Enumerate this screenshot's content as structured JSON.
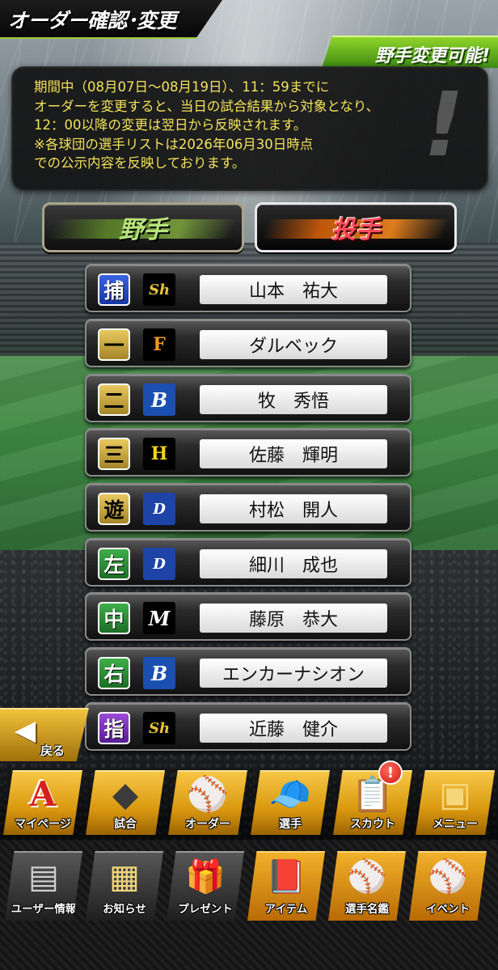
{
  "header": {
    "title": "オーダー確認･変更",
    "badge": "野手変更可能!"
  },
  "notice": {
    "text": "期間中（08月07日～08月19日）、11：59までに\nオーダーを変更すると、当日の試合結果から対象となり、\n12：00以降の変更は翌日から反映されます。\n※各球団の選手リストは2026年06月30日時点\nでの公示内容を反映しております。",
    "mark": "!"
  },
  "tabs": {
    "fielder": "野手",
    "pitcher": "投手"
  },
  "lineup": [
    {
      "position": "捕",
      "team_logo": "Sh",
      "name": "山本　祐大"
    },
    {
      "position": "一",
      "team_logo": "F",
      "name": "ダルベック"
    },
    {
      "position": "二",
      "team_logo": "B",
      "name": "牧　秀悟"
    },
    {
      "position": "三",
      "team_logo": "H",
      "name": "佐藤　輝明"
    },
    {
      "position": "遊",
      "team_logo": "D",
      "name": "村松　開人"
    },
    {
      "position": "左",
      "team_logo": "D",
      "name": "細川　成也"
    },
    {
      "position": "中",
      "team_logo": "M",
      "name": "藤原　恭大"
    },
    {
      "position": "右",
      "team_logo": "B",
      "name": "エンカーナシオン"
    },
    {
      "position": "指",
      "team_logo": "Sh",
      "name": "近藤　健介"
    }
  ],
  "back_button": {
    "arrow": "◀",
    "label": "戻る"
  },
  "main_menu": [
    {
      "icon": "A",
      "label": "マイページ"
    },
    {
      "icon": "◆",
      "label": "試合"
    },
    {
      "icon": "⚾",
      "label": "オーダー"
    },
    {
      "icon": "🧢",
      "label": "選手"
    },
    {
      "icon": "📋",
      "label": "スカウト"
    },
    {
      "icon": "▣",
      "label": "メニュー"
    }
  ],
  "alert_badge": "!",
  "sub_menu": [
    {
      "icon": "▤",
      "label": "ユーザー情報"
    },
    {
      "icon": "▦",
      "label": "お知らせ"
    },
    {
      "icon": "🎁",
      "label": "プレゼント"
    },
    {
      "icon": "📕",
      "label": "アイテム"
    },
    {
      "icon": "⚾",
      "label": "選手名鑑"
    },
    {
      "icon": "⚾",
      "label": "イベント"
    }
  ],
  "colors": {
    "notice_text": "#f3e25a",
    "badge_green": "#6dbf1f",
    "menu_gold": "#e6a51c",
    "pitcher_tab_text": "#ff4d5a"
  }
}
